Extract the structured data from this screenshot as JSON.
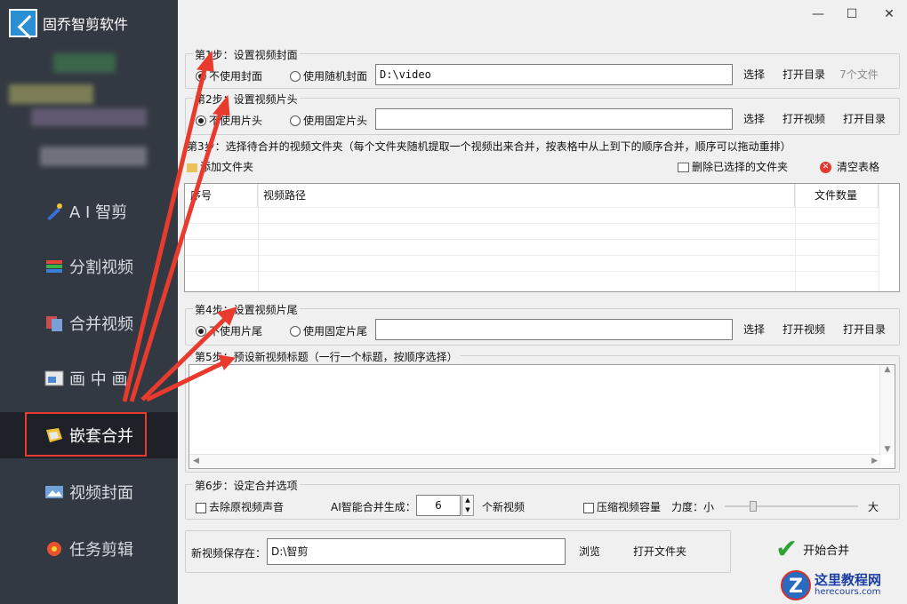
{
  "app": {
    "title": "固乔智剪软件"
  },
  "window": {
    "minimize": "—",
    "maximize": "☐",
    "close": "✕"
  },
  "sidebar": {
    "items": [
      {
        "label": "A I 智剪",
        "icon": "ai-wand-icon"
      },
      {
        "label": "分割视频",
        "icon": "layers-icon"
      },
      {
        "label": "合并视频",
        "icon": "merge-icon"
      },
      {
        "label": "画 中 画",
        "icon": "picture-in-picture-icon"
      },
      {
        "label": "嵌套合并",
        "icon": "nest-merge-icon",
        "active": true
      },
      {
        "label": "视频封面",
        "icon": "image-icon"
      },
      {
        "label": "任务剪辑",
        "icon": "flower-icon"
      }
    ]
  },
  "step1": {
    "title": "第1步：设置视频封面",
    "opt_none": "不使用封面",
    "opt_random": "使用随机封面",
    "path": "D:\\video",
    "choose": "选择",
    "open_dir": "打开目录",
    "count": "7个文件"
  },
  "step2": {
    "title": "第2步：设置视频片头",
    "opt_none": "不使用片头",
    "opt_fixed": "使用固定片头",
    "path": "",
    "choose": "选择",
    "open_video": "打开视频",
    "open_dir": "打开目录"
  },
  "step3": {
    "title": "第3步：选择待合并的视频文件夹（每个文件夹随机提取一个视频出来合并，按表格中从上到下的顺序合并，顺序可以拖动重排）",
    "add_folder": "添加文件夹",
    "remove_selected": "删除已选择的文件夹",
    "clear_table": "清空表格",
    "columns": [
      "序号",
      "视频路径",
      "文件数量"
    ]
  },
  "step4": {
    "title": "第4步：设置视频片尾",
    "opt_none": "不使用片尾",
    "opt_fixed": "使用固定片尾",
    "path": "",
    "choose": "选择",
    "open_video": "打开视频",
    "open_dir": "打开目录"
  },
  "step5": {
    "title": "第5步：预设新视频标题（一行一个标题，按顺序选择）",
    "content": ""
  },
  "step6": {
    "title": "第6步：设定合并选项",
    "remove_audio": "去除原视频声音",
    "ai_label": "AI智能合并生成：",
    "ai_count": "6",
    "ai_unit": "个新视频",
    "compress": "压缩视频容量",
    "strength": "力度：小",
    "strength_max": "大",
    "strength_value": 0.2
  },
  "save": {
    "label": "新视频保存在：",
    "path": "D:\\智剪",
    "browse": "浏览",
    "open_folder": "打开文件夹"
  },
  "start": {
    "label": "开始合并"
  },
  "watermark": {
    "line1": "这里教程网",
    "line2": "herecours.com",
    "logo": "Z"
  }
}
